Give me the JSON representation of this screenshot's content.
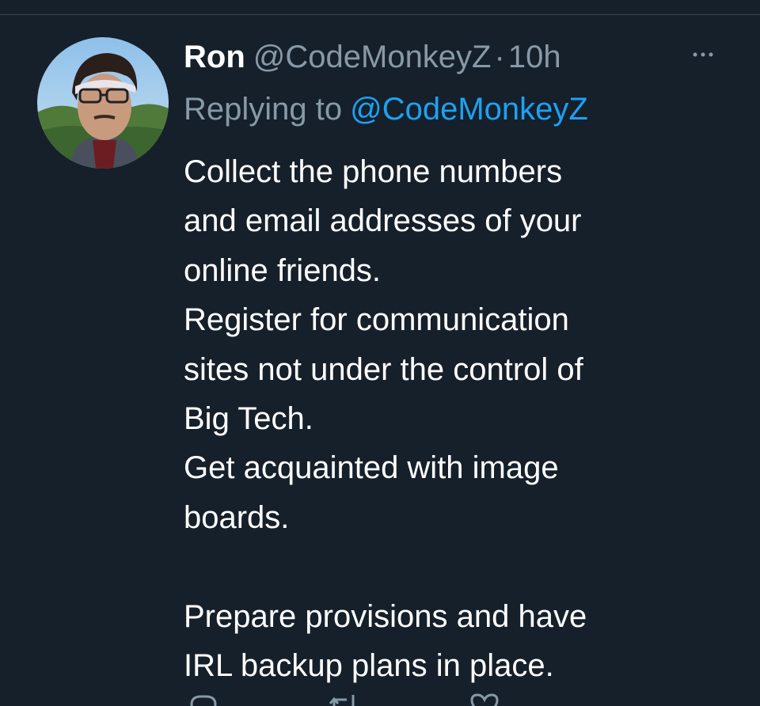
{
  "tweet": {
    "author_name": "Ron",
    "author_handle": "@CodeMonkeyZ",
    "separator": "·",
    "time": "10h",
    "replying_prefix": "Replying to",
    "replying_handle": "@CodeMonkeyZ",
    "text_lines": [
      "Collect the phone numbers",
      "and email addresses of your",
      "online friends.",
      "Register for communication",
      "sites not under the control of",
      "Big Tech.",
      "Get acquainted with image",
      "boards.",
      "",
      "Prepare provisions and have",
      "IRL backup plans in place."
    ]
  },
  "icons": {
    "more": "more-horizontal-icon",
    "reply": "reply-icon",
    "retweet": "retweet-icon",
    "like": "like-icon"
  },
  "colors": {
    "background": "#15202b",
    "text": "#ffffff",
    "secondary_text": "#8899a6",
    "link": "#1da1f2",
    "divider": "#38444d"
  }
}
